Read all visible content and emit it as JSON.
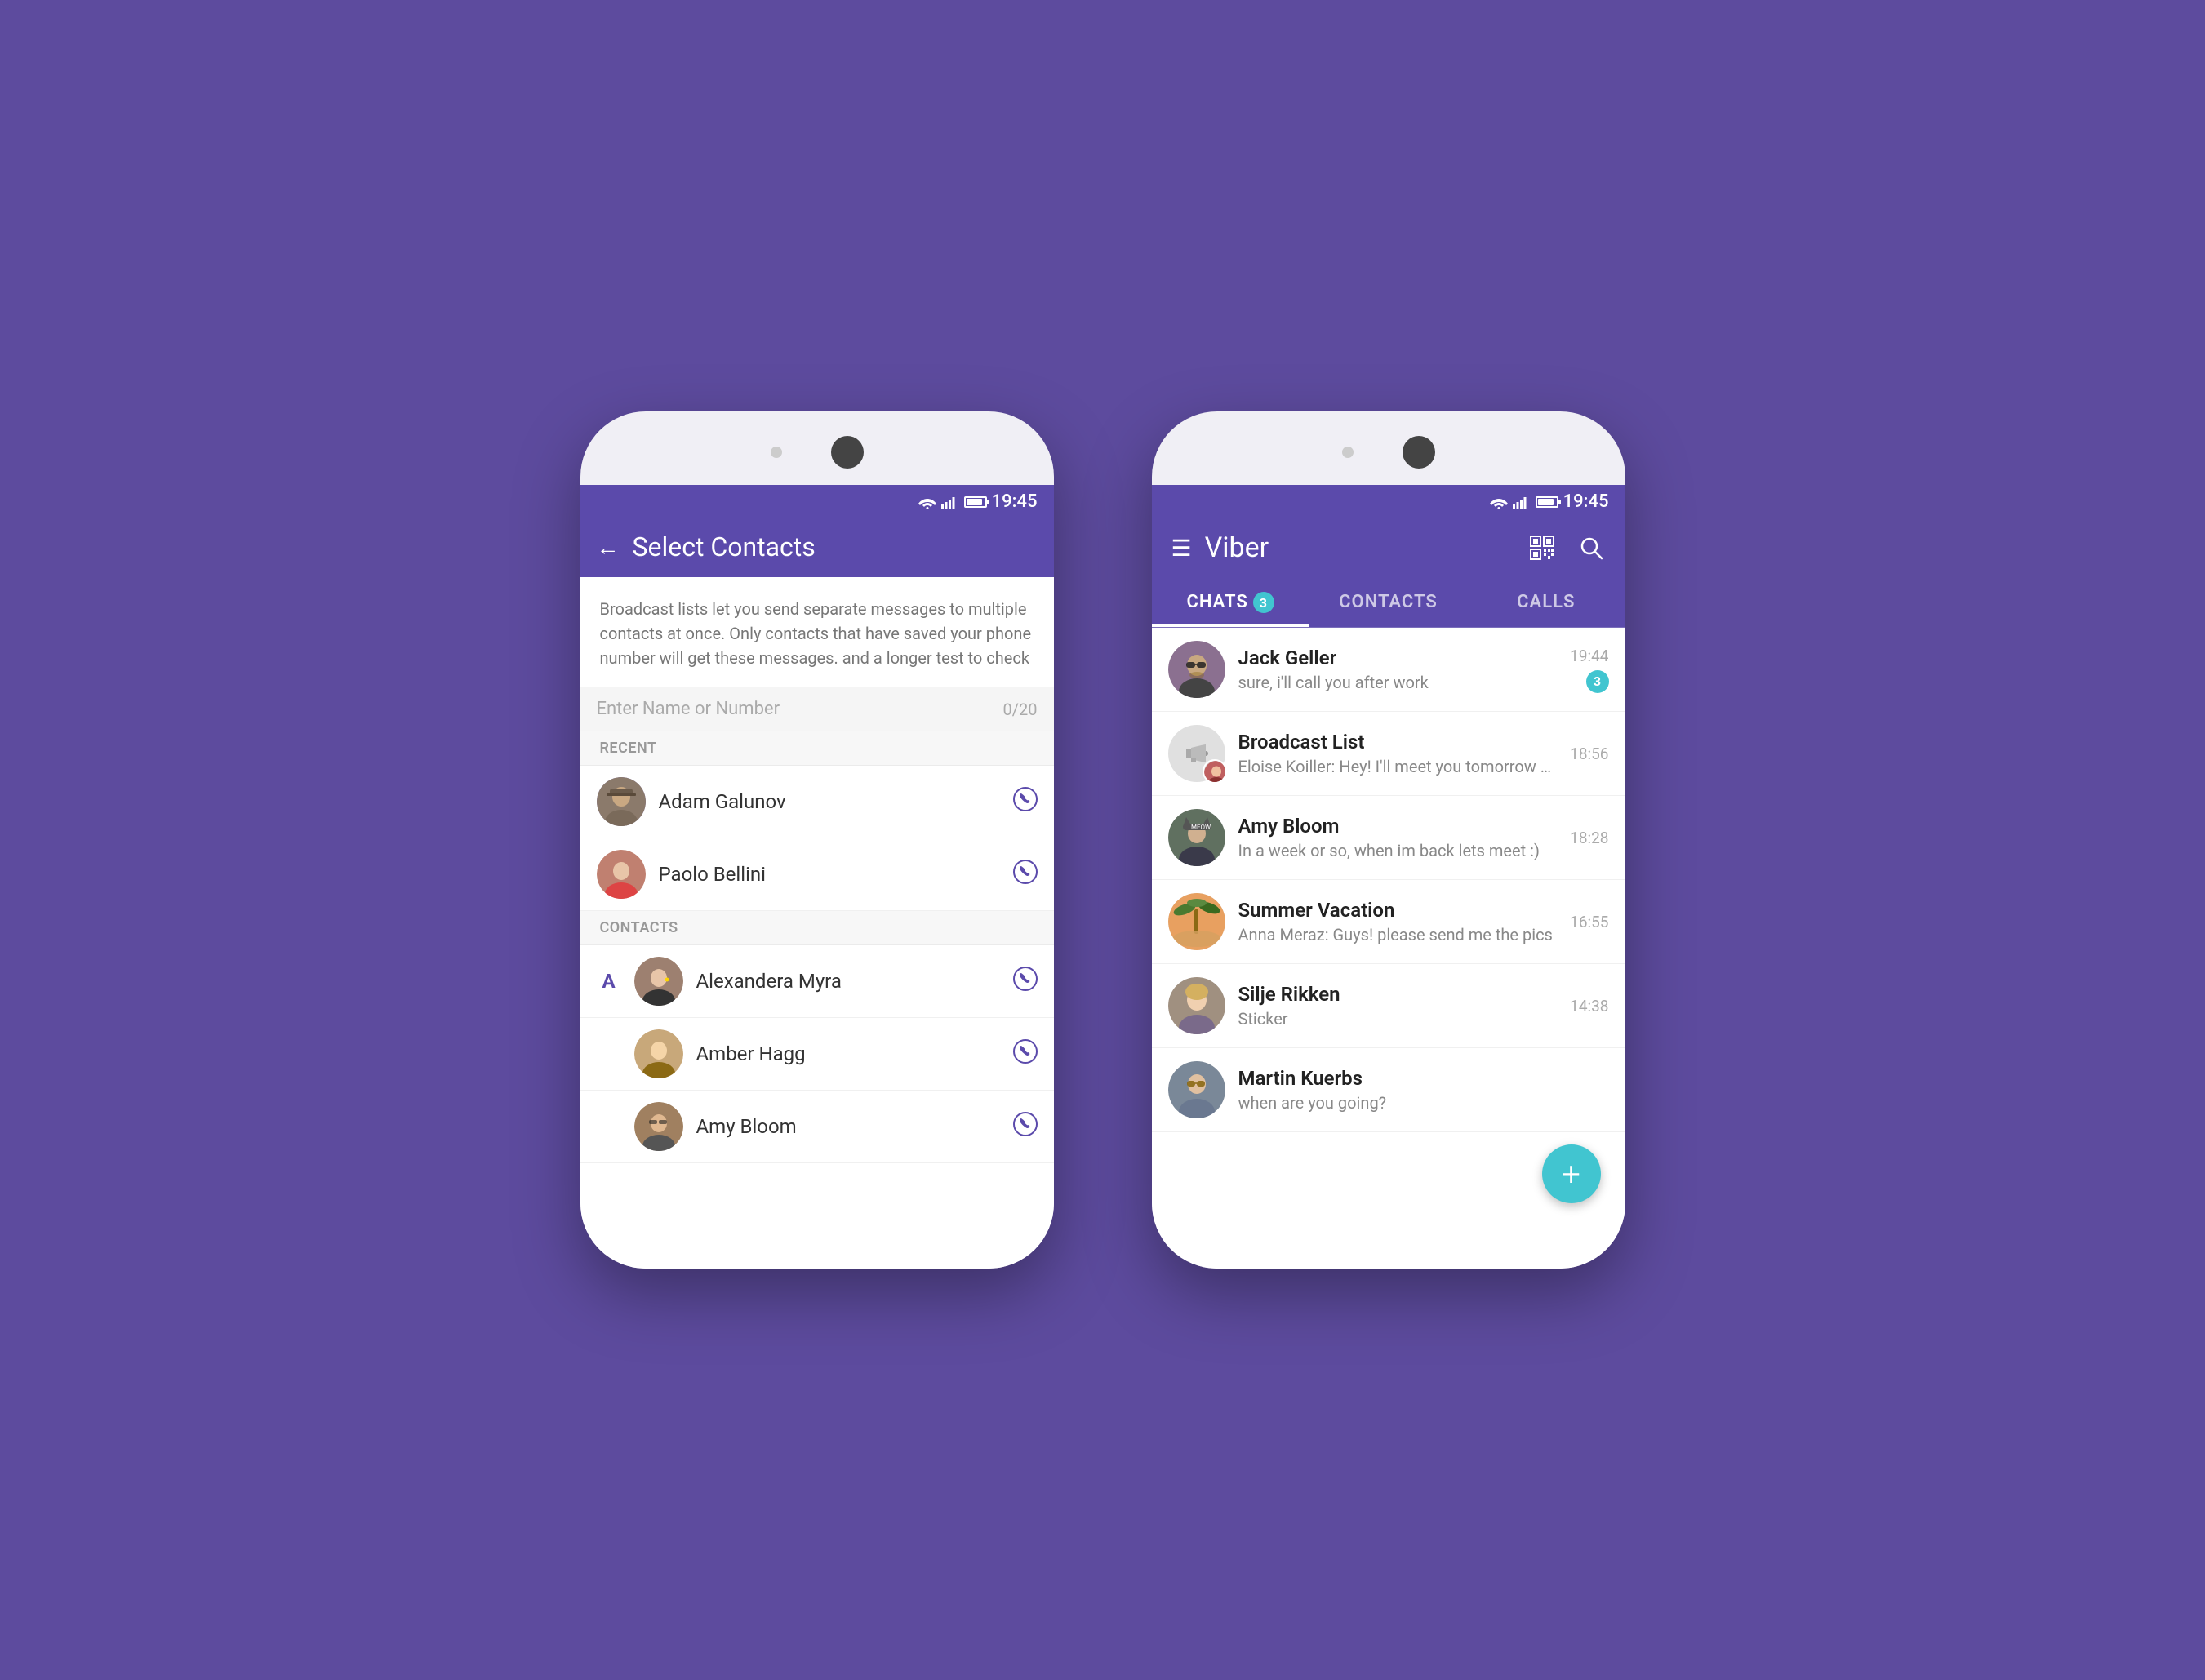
{
  "background": "#5d4b9e",
  "phone1": {
    "statusBar": {
      "time": "19:45"
    },
    "header": {
      "backLabel": "←",
      "title": "Select Contacts"
    },
    "infoText": "Broadcast lists let you send separate messages to multiple contacts at once. Only contacts that have saved your phone number will get these messages. and a longer test to check",
    "searchPlaceholder": "Enter Name or Number",
    "searchCounter": "0/20",
    "recentLabel": "RECENT",
    "recentContacts": [
      {
        "name": "Adam Galunov"
      },
      {
        "name": "Paolo Bellini"
      }
    ],
    "contactsLabel": "CONTACTS",
    "alphaLetter": "A",
    "contacts": [
      {
        "name": "Alexandera Myra"
      },
      {
        "name": "Amber Hagg"
      },
      {
        "name": "Amy Bloom"
      }
    ]
  },
  "phone2": {
    "statusBar": {
      "time": "19:45"
    },
    "header": {
      "menuLabel": "☰",
      "appName": "Viber"
    },
    "tabs": [
      {
        "label": "CHATS",
        "badge": "3",
        "active": true
      },
      {
        "label": "CONTACTS",
        "badge": null,
        "active": false
      },
      {
        "label": "CALLS",
        "badge": null,
        "active": false
      }
    ],
    "chats": [
      {
        "name": "Jack Geller",
        "preview": "sure, i'll call you after work",
        "time": "19:44",
        "unread": "3",
        "avatarColor": "#8b7db5"
      },
      {
        "name": "Broadcast List",
        "preview": "Eloise Koiller: Hey! I'll meet you tomorrow at R...",
        "time": "18:56",
        "unread": null,
        "avatarColor": "#e0e0e0"
      },
      {
        "name": "Amy Bloom",
        "preview": "In a week or so, when im back lets meet :)",
        "time": "18:28",
        "unread": null,
        "avatarColor": "#8b7db5"
      },
      {
        "name": "Summer Vacation",
        "preview": "Anna Meraz: Guys! please send me the pics",
        "time": "16:55",
        "unread": null,
        "avatarColor": "#cc8844"
      },
      {
        "name": "Silje Rikken",
        "preview": "Sticker",
        "time": "14:38",
        "unread": null,
        "avatarColor": "#a0887a"
      },
      {
        "name": "Martin Kuerbs",
        "preview": "when are you going?",
        "time": "",
        "unread": null,
        "avatarColor": "#6677aa"
      }
    ],
    "fabLabel": "+"
  }
}
